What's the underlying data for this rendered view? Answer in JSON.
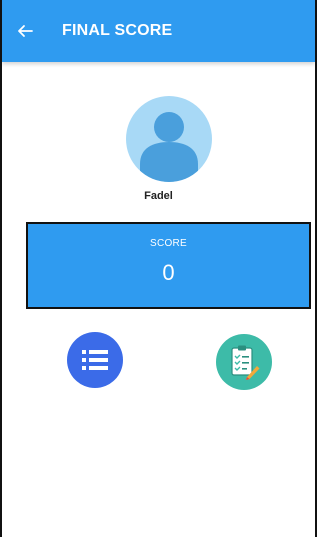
{
  "header": {
    "back_icon": "arrow-left-icon",
    "title": "FINAL SCORE"
  },
  "profile": {
    "avatar_icon": "user-avatar-icon",
    "name": "Fadel"
  },
  "score": {
    "label": "SCORE",
    "value": "0"
  },
  "actions": [
    {
      "icon": "list-icon"
    },
    {
      "icon": "checklist-edit-icon"
    }
  ],
  "colors": {
    "primary": "#2f9bf0",
    "avatar_bg": "#a8d9f6",
    "avatar_fg": "#4a9fdc",
    "list_button": "#3b6be8",
    "review_button": "#3dbba8"
  }
}
